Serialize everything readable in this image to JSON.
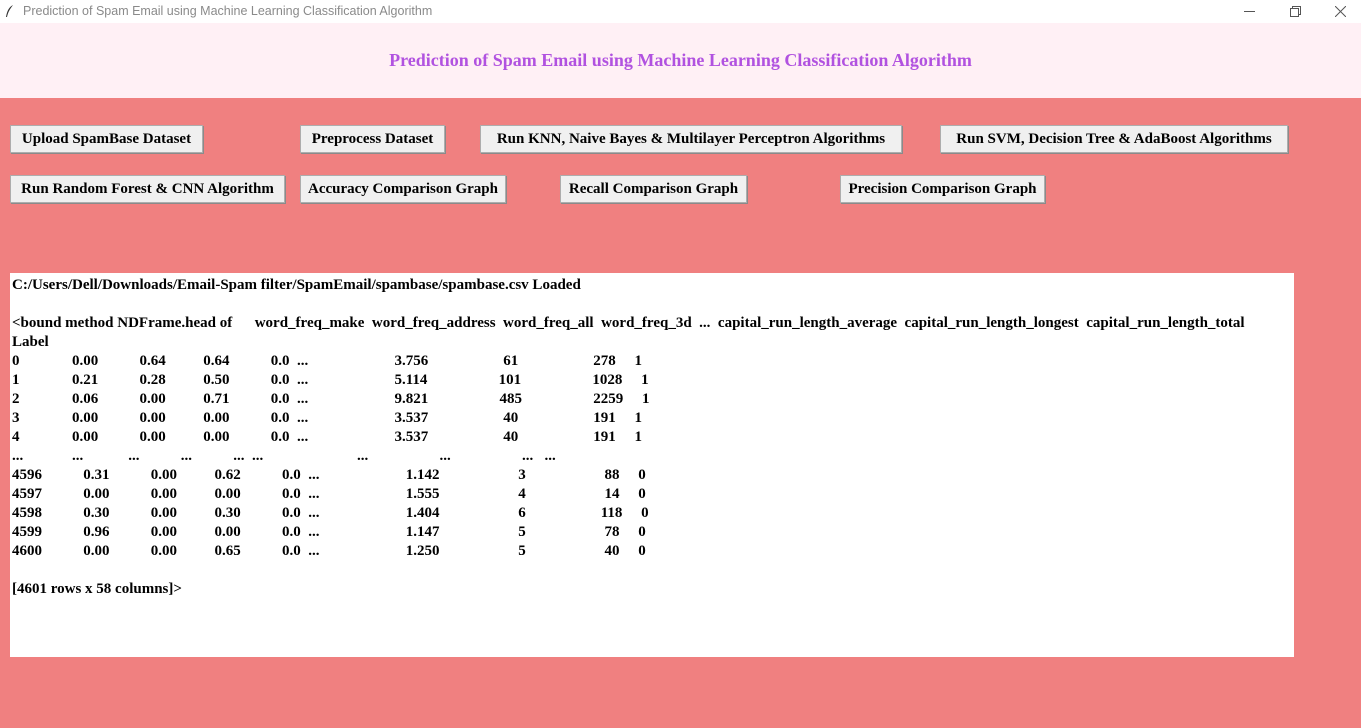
{
  "window": {
    "title": "Prediction of Spam Email using Machine Learning Classification Algorithm"
  },
  "header": {
    "title": "Prediction of Spam Email using Machine Learning Classification Algorithm"
  },
  "colors": {
    "background": "#f08080",
    "header_band": "#fff0f5",
    "title_text": "#b152e0",
    "button_bg": "#f0f0f0"
  },
  "buttons": {
    "upload": "Upload SpamBase Dataset",
    "preprocess": "Preprocess Dataset",
    "run_knn": "Run KNN, Naive Bayes & Multilayer Perceptron Algorithms",
    "run_svm": "Run SVM, Decision Tree & AdaBoost Algorithms",
    "run_rf": "Run Random Forest & CNN Algorithm",
    "accuracy_graph": "Accuracy Comparison Graph",
    "recall_graph": "Recall Comparison Graph",
    "precision_graph": "Precision Comparison Graph"
  },
  "output": {
    "text": "C:/Users/Dell/Downloads/Email-Spam filter/SpamEmail/spambase/spambase.csv Loaded\n\n<bound method NDFrame.head of      word_freq_make  word_freq_address  word_freq_all  word_freq_3d  ...  capital_run_length_average  capital_run_length_longest  capital_run_length_total\nLabel\n0              0.00           0.64          0.64           0.0  ...                       3.756                    61                    278     1\n1              0.21           0.28          0.50           0.0  ...                       5.114                   101                   1028     1\n2              0.06           0.00          0.71           0.0  ...                       9.821                   485                   2259     1\n3              0.00           0.00          0.00           0.0  ...                       3.537                    40                    191     1\n4              0.00           0.00          0.00           0.0  ...                       3.537                    40                    191     1\n...             ...            ...           ...           ...  ...                         ...                   ...                   ...   ...\n4596           0.31           0.00          0.62           0.0  ...                       1.142                     3                     88     0\n4597           0.00           0.00          0.00           0.0  ...                       1.555                     4                     14     0\n4598           0.30           0.00          0.30           0.0  ...                       1.404                     6                    118     0\n4599           0.96           0.00          0.00           0.0  ...                       1.147                     5                     78     0\n4600           0.00           0.00          0.65           0.0  ...                       1.250                     5                     40     0\n\n[4601 rows x 58 columns]>"
  }
}
